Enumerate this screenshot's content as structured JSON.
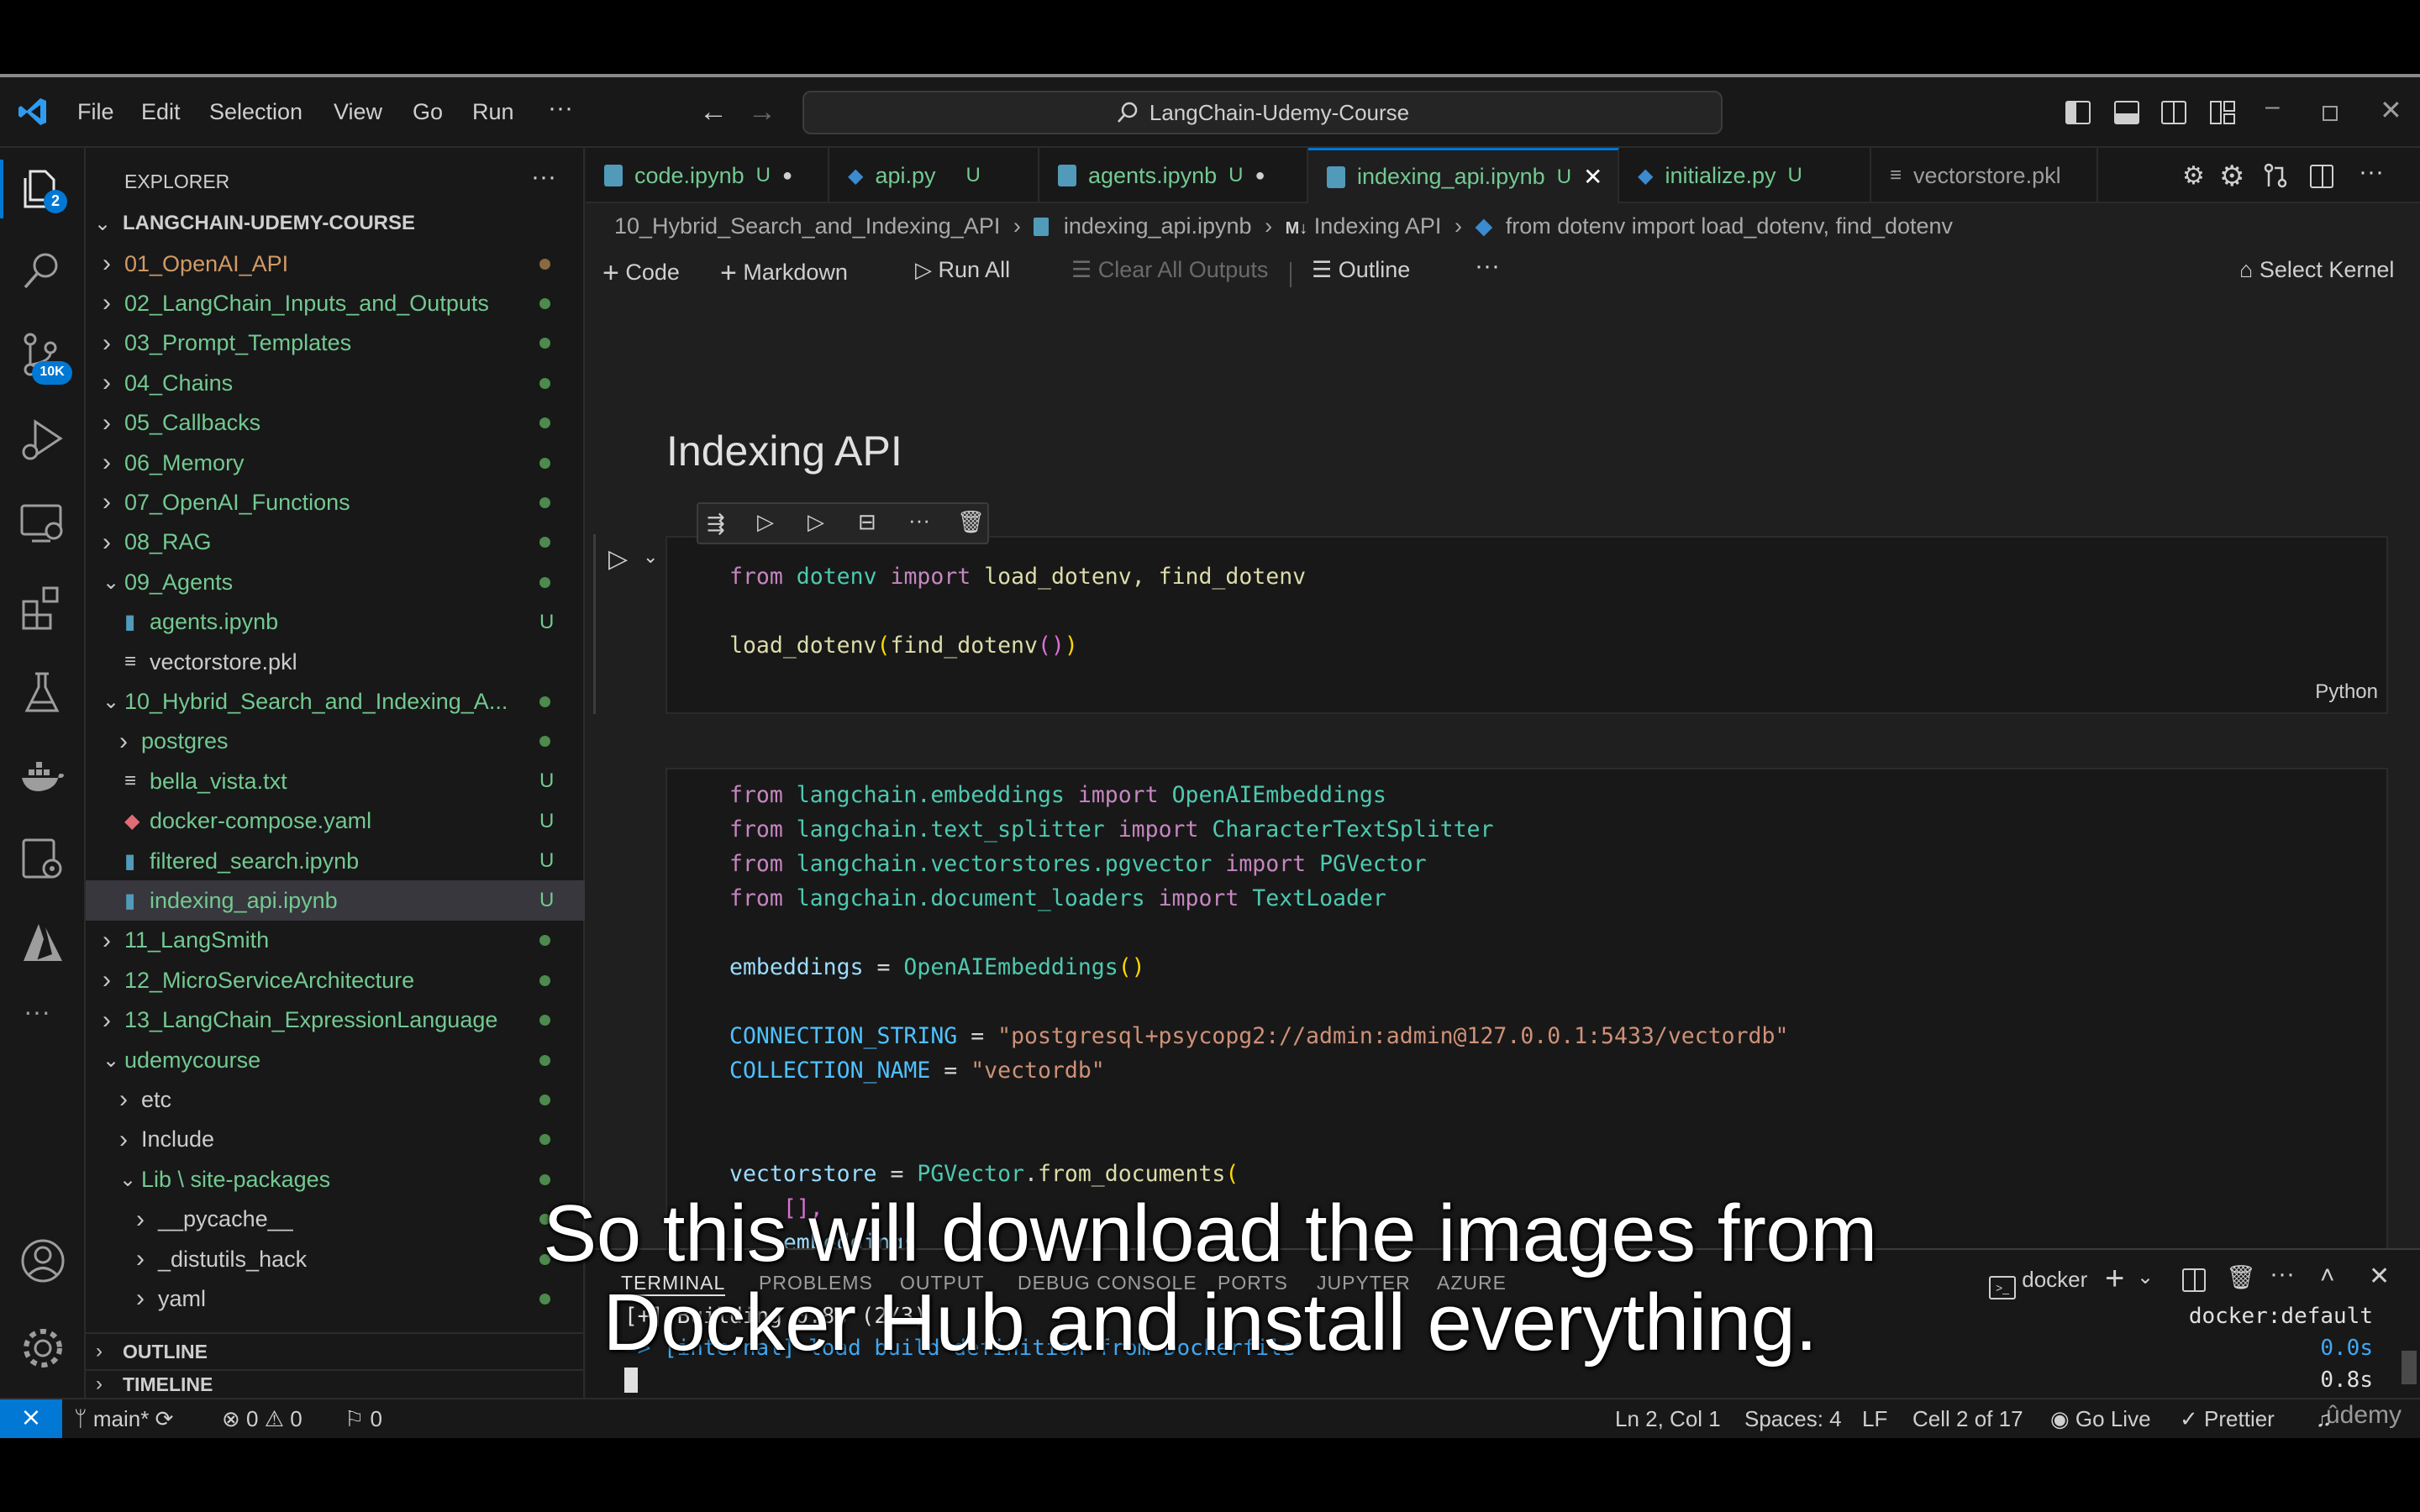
{
  "window": {
    "menu": [
      "File",
      "Edit",
      "Selection",
      "View",
      "Go",
      "Run"
    ],
    "more": "···",
    "search": "LangChain-Udemy-Course"
  },
  "activity": {
    "explorer_badge": "2",
    "scm_badge": "10K",
    "more": "···"
  },
  "sidebar": {
    "title": "EXPLORER",
    "more": "···",
    "root": "LANGCHAIN-UDEMY-COURSE",
    "items": [
      {
        "label": "01_OpenAI_API",
        "status": "",
        "color": "#d19a66"
      },
      {
        "label": "02_LangChain_Inputs_and_Outputs",
        "status": "",
        "color": "#73c991"
      },
      {
        "label": "03_Prompt_Templates",
        "status": "",
        "color": "#73c991"
      },
      {
        "label": "04_Chains",
        "status": "",
        "color": "#73c991"
      },
      {
        "label": "05_Callbacks",
        "status": "",
        "color": "#73c991"
      },
      {
        "label": "06_Memory",
        "status": "",
        "color": "#73c991"
      },
      {
        "label": "07_OpenAI_Functions",
        "status": "",
        "color": "#73c991"
      },
      {
        "label": "08_RAG",
        "status": "",
        "color": "#73c991"
      },
      {
        "label": "09_Agents",
        "status": "",
        "color": "#73c991"
      },
      {
        "label": "agents.ipynb",
        "status": "U",
        "color": "#73c991"
      },
      {
        "label": "vectorstore.pkl",
        "status": "",
        "color": "#cccccc"
      },
      {
        "label": "10_Hybrid_Search_and_Indexing_A...",
        "status": "",
        "color": "#73c991"
      },
      {
        "label": "postgres",
        "status": "",
        "color": "#73c991"
      },
      {
        "label": "bella_vista.txt",
        "status": "U",
        "color": "#73c991"
      },
      {
        "label": "docker-compose.yaml",
        "status": "U",
        "color": "#73c991"
      },
      {
        "label": "filtered_search.ipynb",
        "status": "U",
        "color": "#73c991"
      },
      {
        "label": "indexing_api.ipynb",
        "status": "U",
        "color": "#73c991"
      },
      {
        "label": "11_LangSmith",
        "status": "",
        "color": "#73c991"
      },
      {
        "label": "12_MicroServiceArchitecture",
        "status": "",
        "color": "#73c991"
      },
      {
        "label": "13_LangChain_ExpressionLanguage",
        "status": "",
        "color": "#73c991"
      },
      {
        "label": "udemycourse",
        "status": "",
        "color": "#73c991"
      },
      {
        "label": "etc",
        "status": "",
        "color": "#cccccc"
      },
      {
        "label": "Include",
        "status": "",
        "color": "#cccccc"
      },
      {
        "label": "Lib \\ site-packages",
        "status": "",
        "color": "#73c991"
      },
      {
        "label": "__pycache__",
        "status": "",
        "color": "#cccccc"
      },
      {
        "label": "_distutils_hack",
        "status": "",
        "color": "#cccccc"
      },
      {
        "label": "yaml",
        "status": "",
        "color": "#cccccc"
      }
    ],
    "outline": "OUTLINE",
    "timeline": "TIMELINE"
  },
  "tabs": [
    {
      "label": "code.ipynb",
      "status": "U"
    },
    {
      "label": "api.py",
      "status": "U"
    },
    {
      "label": "agents.ipynb",
      "status": "U"
    },
    {
      "label": "indexing_api.ipynb",
      "status": "U"
    },
    {
      "label": "initialize.py",
      "status": "U"
    },
    {
      "label": "vectorstore.pkl",
      "status": ""
    }
  ],
  "breadcrumbs": {
    "folder": "10_Hybrid_Search_and_Indexing_API",
    "file": "indexing_api.ipynb",
    "md_prefix": "M↓",
    "section": "Indexing API",
    "symbol": "from dotenv import load_dotenv, find_dotenv"
  },
  "toolbar": {
    "code": "Code",
    "markdown": "Markdown",
    "run_all": "Run All",
    "clear": "Clear All Outputs",
    "outline": "Outline",
    "more": "···",
    "kernel": "Select Kernel"
  },
  "notebook": {
    "heading": "Indexing API",
    "cell1_lang": "Python",
    "cell1": {
      "l1": {
        "a": "from",
        "b": "dotenv",
        "c": "import",
        "d": "load_dotenv, find_dotenv"
      },
      "l2": {
        "a": "load_dotenv",
        "b": "(",
        "c": "find_dotenv",
        "d": "()",
        "e": ")"
      }
    },
    "cell2": {
      "imp1": {
        "a": "from",
        "b": "langchain.embeddings",
        "c": "import",
        "d": "OpenAIEmbeddings"
      },
      "imp2": {
        "a": "from",
        "b": "langchain.text_splitter",
        "c": "import",
        "d": "CharacterTextSplitter"
      },
      "imp3": {
        "a": "from",
        "b": "langchain.vectorstores.pgvector",
        "c": "import",
        "d": "PGVector"
      },
      "imp4": {
        "a": "from",
        "b": "langchain.document_loaders",
        "c": "import",
        "d": "TextLoader"
      },
      "emb": {
        "a": "embeddings",
        "b": " = ",
        "c": "OpenAIEmbeddings",
        "d": "()"
      },
      "conn": {
        "a": "CONNECTION_STRING",
        "b": " = ",
        "c": "\"postgresql+psycopg2://admin:admin@127.0.0.1:5433/vectordb\""
      },
      "coll": {
        "a": "COLLECTION_NAME",
        "b": " = ",
        "c": "\"vectordb\""
      },
      "vs": {
        "a": "vectorstore",
        "b": " = ",
        "c": "PGVector",
        "d": ".",
        "e": "from_documents",
        "f": "("
      },
      "list": "[],",
      "partial": "embeddings"
    }
  },
  "panel": {
    "tabs": [
      "TERMINAL",
      "PROBLEMS",
      "OUTPUT",
      "DEBUG CONSOLE",
      "PORTS",
      "JUPYTER",
      "AZURE"
    ],
    "terminal_name": "docker",
    "line1": "[+] Building 0.8s (2/3)",
    "line2": "=> [internal] load build definition from Dockerfile",
    "right1": "docker:default",
    "right2": "0.0s",
    "right3": "0.8s"
  },
  "status": {
    "branch": "main*",
    "errors": "0",
    "warnings": "0",
    "ports": "0",
    "position": "Ln 2, Col 1",
    "spaces": "Spaces: 4",
    "eol": "LF",
    "cell": "Cell 2 of 17",
    "golive": "Go Live",
    "prettier": "Prettier",
    "watermark": "ûdemy"
  },
  "caption": {
    "line1": "So this will download the images from",
    "line2": "Docker Hub and install everything."
  },
  "colors": {
    "accent": "#0078d4",
    "untracked": "#73c991",
    "remote": "#0078d4"
  }
}
